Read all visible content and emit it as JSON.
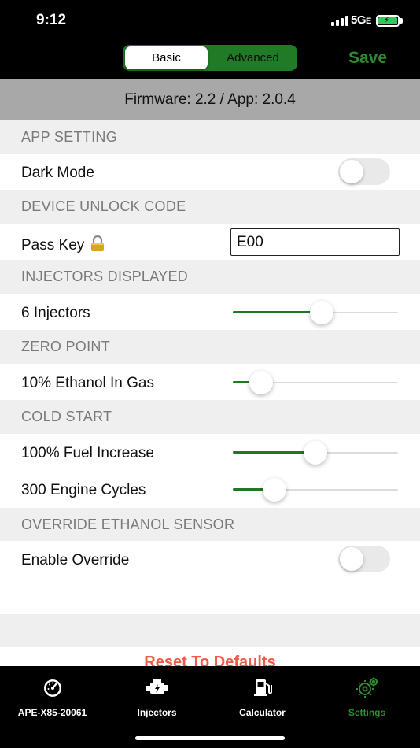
{
  "status_bar": {
    "time": "9:12",
    "network": "5G",
    "network_suffix": "E"
  },
  "nav": {
    "segments": [
      "Basic",
      "Advanced"
    ],
    "selected_segment": "Basic",
    "save_label": "Save"
  },
  "firmware_text": "Firmware: 2.2 / App: 2.0.4",
  "sections": {
    "app_setting": "APP SETTING",
    "device_unlock": "DEVICE UNLOCK CODE",
    "injectors_displayed": "INJECTORS DISPLAYED",
    "zero_point": "ZERO POINT",
    "cold_start": "COLD START",
    "override": "OVERRIDE ETHANOL SENSOR"
  },
  "rows": {
    "dark_mode": {
      "label": "Dark Mode",
      "on": false
    },
    "pass_key": {
      "label": "Pass Key",
      "value": "E00"
    },
    "injectors": {
      "label": "6 Injectors",
      "level": 0.54
    },
    "ethanol_in_gas": {
      "label": "10% Ethanol In Gas",
      "level": 0.17
    },
    "fuel_increase": {
      "label": "100% Fuel Increase",
      "level": 0.5
    },
    "engine_cycles": {
      "label": "300 Engine Cycles",
      "level": 0.25
    },
    "enable_override": {
      "label": "Enable Override",
      "on": false
    }
  },
  "reset_label": "Reset To Defaults",
  "tabs": [
    {
      "label": "APE-X85-20061",
      "icon": "gauge-icon"
    },
    {
      "label": "Injectors",
      "icon": "engine-icon"
    },
    {
      "label": "Calculator",
      "icon": "fuel-pump-icon"
    },
    {
      "label": "Settings",
      "icon": "gear-icon",
      "active": true
    }
  ],
  "colors": {
    "accent": "#2c8a2c",
    "reset": "#f05a47",
    "section_bg": "#efefef",
    "banner_bg": "#a8a8a8"
  }
}
